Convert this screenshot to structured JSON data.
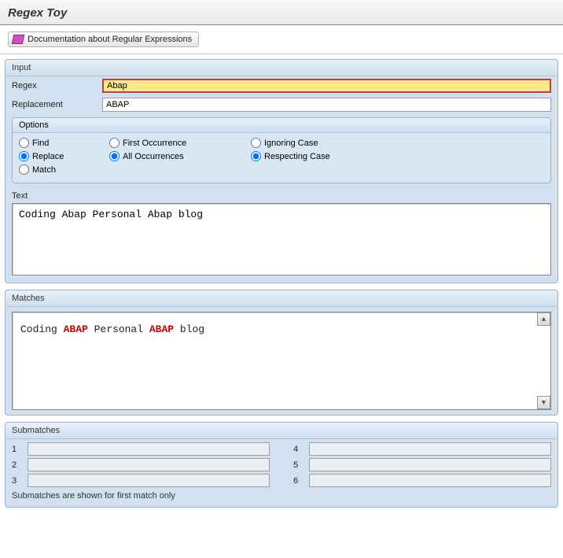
{
  "title": "Regex Toy",
  "toolbar": {
    "doc_button": "Documentation about Regular Expressions"
  },
  "input_group": {
    "title": "Input",
    "regex_label": "Regex",
    "regex_value": "Abap",
    "replacement_label": "Replacement",
    "replacement_value": "ABAP",
    "options_title": "Options",
    "options": {
      "col1": [
        {
          "name": "mode",
          "label": "Find",
          "checked": false
        },
        {
          "name": "mode",
          "label": "Replace",
          "checked": true
        },
        {
          "name": "mode",
          "label": "Match",
          "checked": false
        }
      ],
      "col2": [
        {
          "name": "occ",
          "label": "First Occurrence",
          "checked": false
        },
        {
          "name": "occ",
          "label": "All Occurrences",
          "checked": true
        }
      ],
      "col3": [
        {
          "name": "case",
          "label": "Ignoring Case",
          "checked": false
        },
        {
          "name": "case",
          "label": "Respecting Case",
          "checked": true
        }
      ]
    },
    "text_label": "Text",
    "text_value": "Coding Abap Personal Abap blog"
  },
  "matches_group": {
    "title": "Matches",
    "segments": [
      {
        "text": "Coding ",
        "hl": false
      },
      {
        "text": "ABAP",
        "hl": true
      },
      {
        "text": " Personal ",
        "hl": false
      },
      {
        "text": "ABAP",
        "hl": true
      },
      {
        "text": " blog",
        "hl": false
      }
    ]
  },
  "submatches_group": {
    "title": "Submatches",
    "left": [
      "1",
      "2",
      "3"
    ],
    "right": [
      "4",
      "5",
      "6"
    ],
    "note": "Submatches are shown for first match only"
  }
}
